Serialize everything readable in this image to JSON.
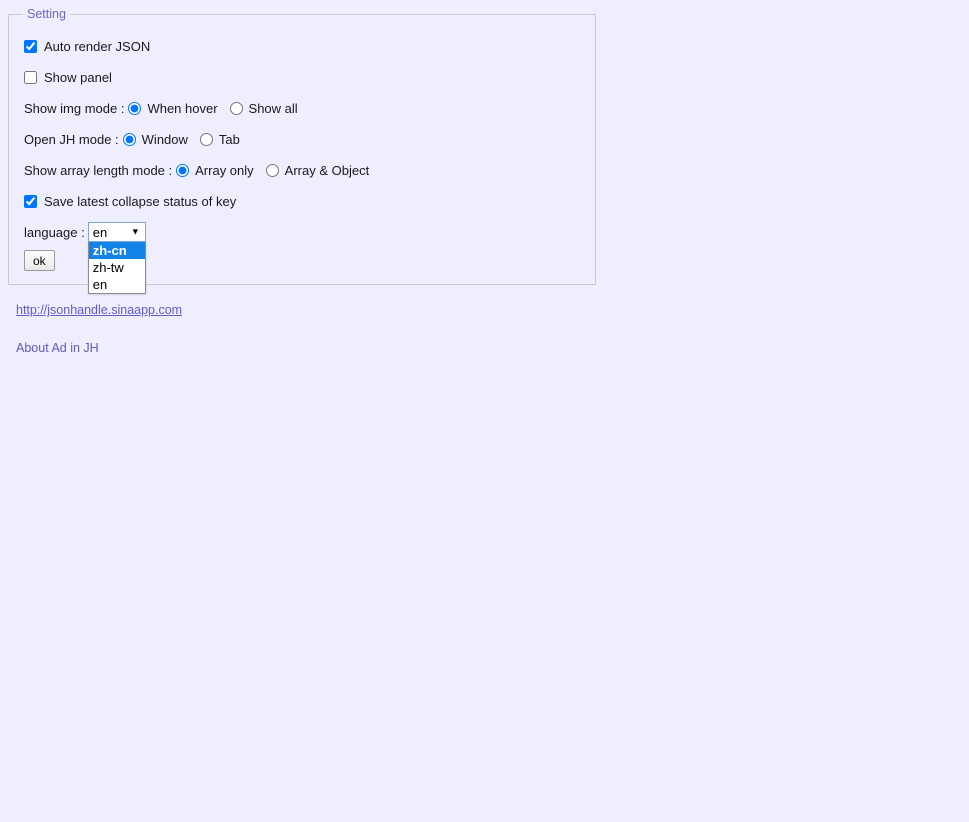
{
  "page": {
    "background_color": "#eeeeff",
    "text_color": "#1a1a1a",
    "link_color": "#5d5dc2",
    "legend_color": "#6c6cc0",
    "highlight_color": "#1284e7"
  },
  "settings": {
    "legend": "Setting",
    "auto_render": {
      "label": "Auto render JSON",
      "checked": true
    },
    "show_panel": {
      "label": "Show panel",
      "checked": false
    },
    "show_img_mode": {
      "label": "Show img mode :",
      "options": [
        {
          "label": "When hover",
          "selected": true
        },
        {
          "label": "Show all",
          "selected": false
        }
      ]
    },
    "open_jh_mode": {
      "label": "Open JH mode :",
      "options": [
        {
          "label": "Window",
          "selected": true
        },
        {
          "label": "Tab",
          "selected": false
        }
      ]
    },
    "show_array_length_mode": {
      "label": "Show array length mode :",
      "options": [
        {
          "label": "Array only",
          "selected": true
        },
        {
          "label": "Array & Object",
          "selected": false
        }
      ]
    },
    "save_collapse": {
      "label": "Save latest collapse status of key",
      "checked": true
    },
    "language": {
      "label": "language :",
      "selected_value": "en",
      "dropdown_open": true,
      "arrow_icon": "▼",
      "options": [
        {
          "value": "zh-cn",
          "highlighted": true
        },
        {
          "value": "zh-tw",
          "highlighted": false
        },
        {
          "value": "en",
          "highlighted": false
        }
      ]
    },
    "submit_button": "ok"
  },
  "footer": {
    "site_link": "http://jsonhandle.sinaapp.com",
    "about_link": "About Ad in JH"
  }
}
